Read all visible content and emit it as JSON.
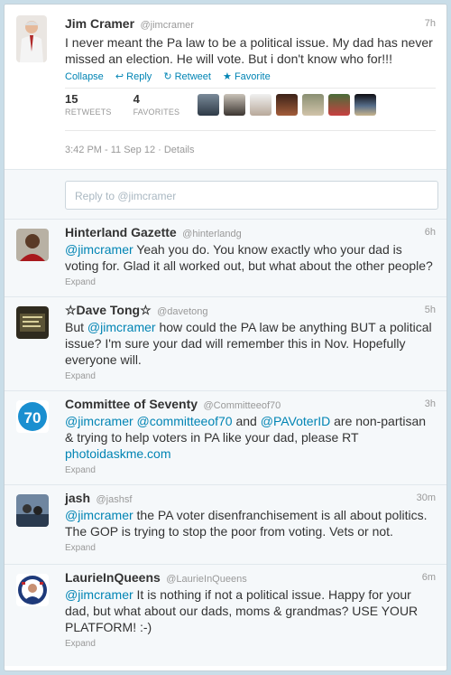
{
  "main_tweet": {
    "name": "Jim Cramer",
    "handle": "@jimcramer",
    "time": "7h",
    "text": "I never meant the Pa law to be a political issue. My dad has never missed an election. He will vote. But i don't know who for!!!",
    "actions": {
      "collapse": "Collapse",
      "reply": "↩ Reply",
      "retweet": "↻ Retweet",
      "favorite": "★ Favorite"
    },
    "retweets": "15",
    "retweets_label": "RETWEETS",
    "favorites": "4",
    "favorites_label": "FAVORITES",
    "timestamp": "3:42 PM - 11 Sep 12 · Details"
  },
  "reply_box": {
    "placeholder": "Reply to @jimcramer"
  },
  "replies": [
    {
      "name": "Hinterland Gazette",
      "handle": "@hinterlandg",
      "time": "6h",
      "mention": "@jimcramer",
      "text": " Yeah you do. You know exactly who your dad is voting for. Glad it all worked out, but what about the other people?",
      "expand": "Expand"
    },
    {
      "name": "☆Dave Tong☆",
      "handle": "@davetong",
      "time": "5h",
      "pre": "But ",
      "mention": "@jimcramer",
      "text": " how could the PA law be anything BUT a political issue? I'm sure your dad will remember this in Nov. Hopefully everyone will.",
      "expand": "Expand"
    },
    {
      "name": "Committee of Seventy",
      "handle": "@Committeeof70",
      "time": "3h",
      "mention": "@jimcramer",
      "mention2": "@committeeof70",
      "mid": " and ",
      "mention3": "@PAVoterID",
      "text": " are non-partisan & trying to help voters in PA like your dad, please RT",
      "link": "photoidaskme.com",
      "expand": "Expand"
    },
    {
      "name": "jash",
      "handle": "@jashsf",
      "time": "30m",
      "mention": "@jimcramer",
      "text": " the PA voter disenfranchisement is all about politics. The GOP is trying to stop the poor from voting. Vets or not.",
      "expand": "Expand"
    },
    {
      "name": "LaurieInQueens",
      "handle": "@LaurieInQueens",
      "time": "6m",
      "mention": "@jimcramer",
      "text": " It is nothing if not a political issue. Happy for your dad, but what about our dads, moms & grandmas? USE YOUR PLATFORM! :-)",
      "expand": "Expand"
    }
  ]
}
